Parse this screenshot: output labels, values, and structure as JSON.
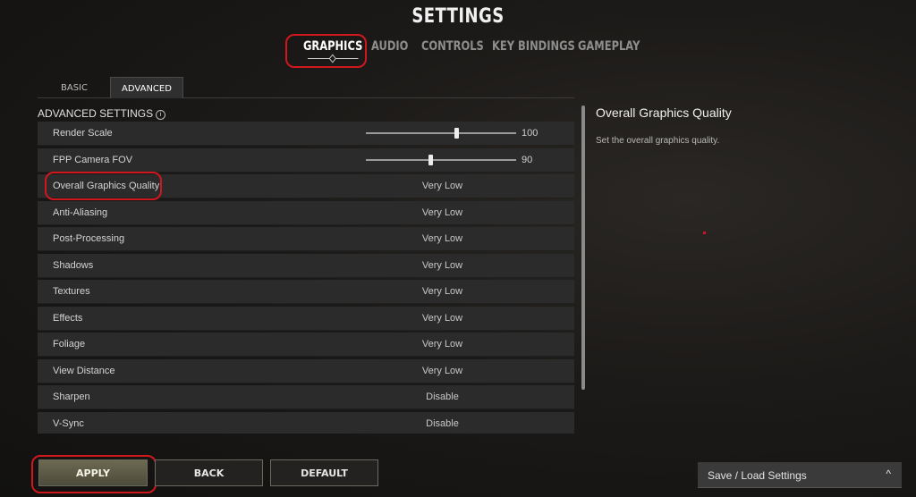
{
  "header": {
    "title": "SETTINGS"
  },
  "main_tabs": [
    {
      "label": "GRAPHICS",
      "active": true
    },
    {
      "label": "AUDIO",
      "active": false
    },
    {
      "label": "CONTROLS",
      "active": false
    },
    {
      "label": "KEY BINDINGS",
      "active": false
    },
    {
      "label": "GAMEPLAY",
      "active": false
    }
  ],
  "sub_tabs": [
    {
      "label": "BASIC",
      "active": false
    },
    {
      "label": "ADVANCED",
      "active": true
    }
  ],
  "section": {
    "title": "ADVANCED SETTINGS",
    "info_icon": "i"
  },
  "rows": [
    {
      "label": "Render Scale",
      "type": "slider",
      "value": "100",
      "fraction": 0.6
    },
    {
      "label": "FPP Camera FOV",
      "type": "slider",
      "value": "90",
      "fraction": 0.43
    },
    {
      "label": "Overall Graphics Quality",
      "type": "option",
      "value": "Very Low"
    },
    {
      "label": "Anti-Aliasing",
      "type": "option",
      "value": "Very Low"
    },
    {
      "label": "Post-Processing",
      "type": "option",
      "value": "Very Low"
    },
    {
      "label": "Shadows",
      "type": "option",
      "value": "Very Low"
    },
    {
      "label": "Textures",
      "type": "option",
      "value": "Very Low"
    },
    {
      "label": "Effects",
      "type": "option",
      "value": "Very Low"
    },
    {
      "label": "Foliage",
      "type": "option",
      "value": "Very Low"
    },
    {
      "label": "View Distance",
      "type": "option",
      "value": "Very Low"
    },
    {
      "label": "Sharpen",
      "type": "option",
      "value": "Disable"
    },
    {
      "label": "V-Sync",
      "type": "option",
      "value": "Disable"
    }
  ],
  "description": {
    "title": "Overall Graphics Quality",
    "text": "Set the overall graphics quality."
  },
  "buttons": {
    "apply": "APPLY",
    "back": "BACK",
    "default": "DEFAULT"
  },
  "save_load": {
    "label": "Save / Load Settings",
    "icon": "^"
  },
  "colors": {
    "highlight_circle": "#d0171d",
    "apply_bg": "#5e5c46"
  }
}
